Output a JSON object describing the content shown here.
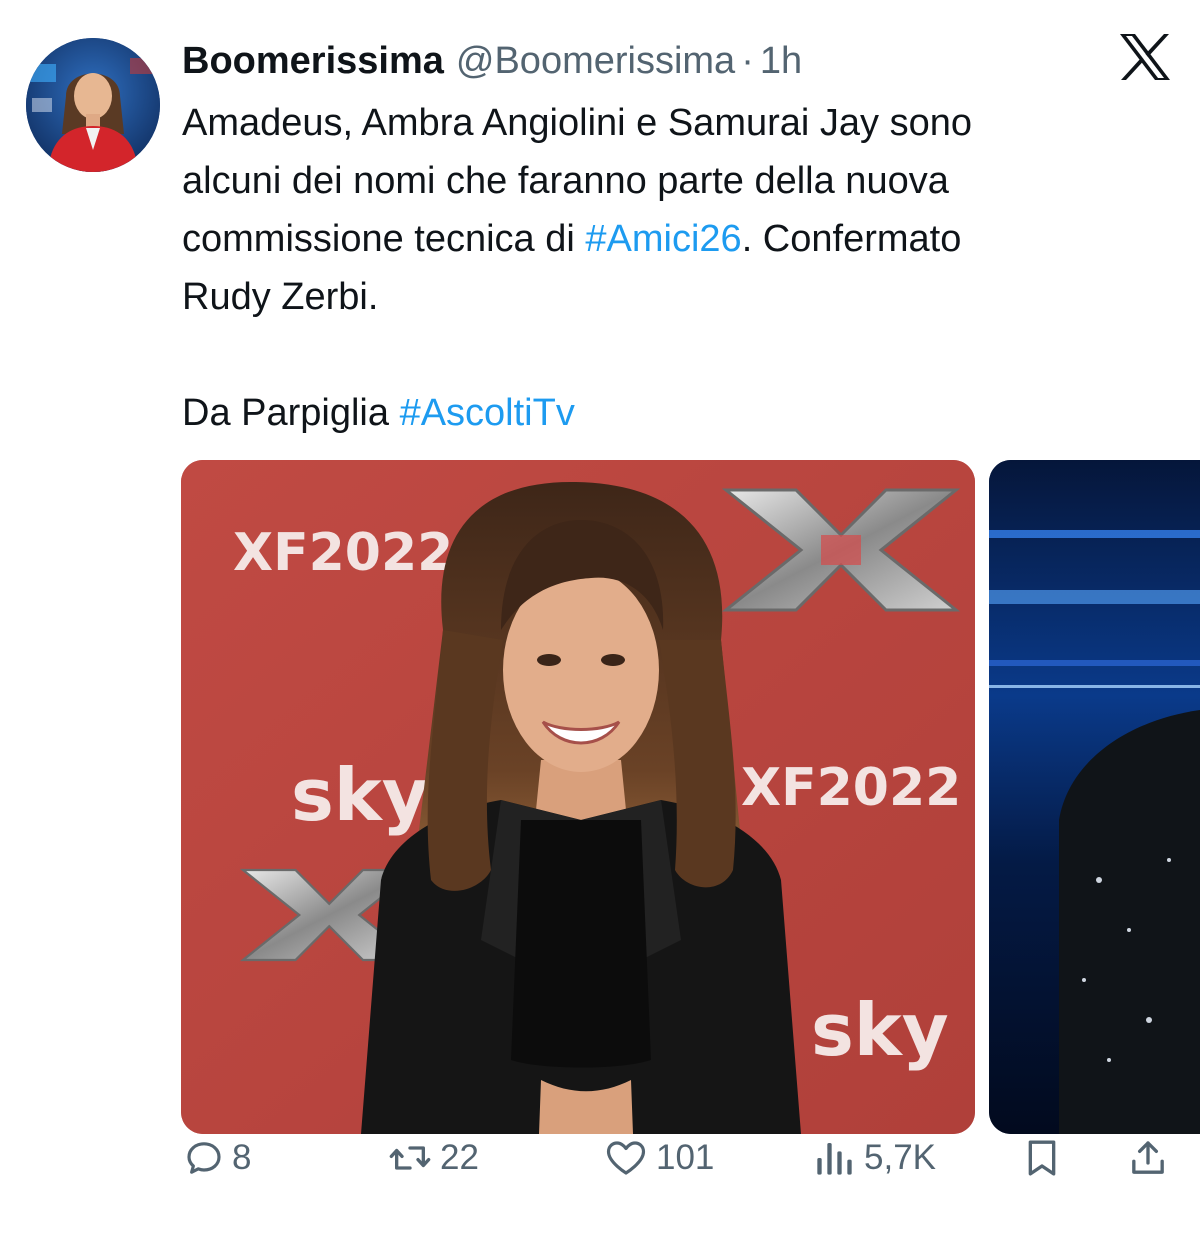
{
  "author": {
    "display_name": "Boomerissima",
    "handle": "@Boomerissima",
    "separator": "·",
    "time": "1h",
    "avatar_icon": "avatar-photo"
  },
  "platform": {
    "logo_icon": "x-logo-icon"
  },
  "tweet": {
    "line1": "Amadeus, Ambra Angiolini e Samurai Jay sono",
    "line2": "alcuni dei nomi che faranno parte della nuova",
    "line3_before": "commissione tecnica di ",
    "line3_hashtag": "#Amici26",
    "line3_after": ". Confermato",
    "line4": "Rudy Zerbi.",
    "line5_before": "Da Parpiglia ",
    "line5_hashtag": "#AscoltiTv"
  },
  "media": [
    {
      "kind": "photo",
      "backdrop_texts": [
        "XF2022",
        "sky",
        "XF2022",
        "sky"
      ]
    },
    {
      "kind": "photo"
    }
  ],
  "actions": {
    "replies": "8",
    "reposts": "22",
    "likes": "101",
    "views": "5,7K",
    "reply_icon": "reply-icon",
    "repost_icon": "repost-icon",
    "like_icon": "heart-icon",
    "views_icon": "views-icon",
    "bookmark_icon": "bookmark-icon",
    "share_icon": "share-icon"
  },
  "colors": {
    "text": "#0f1419",
    "secondary": "#536471",
    "link": "#1d9bf0",
    "media_backdrop": "#b7453f"
  }
}
